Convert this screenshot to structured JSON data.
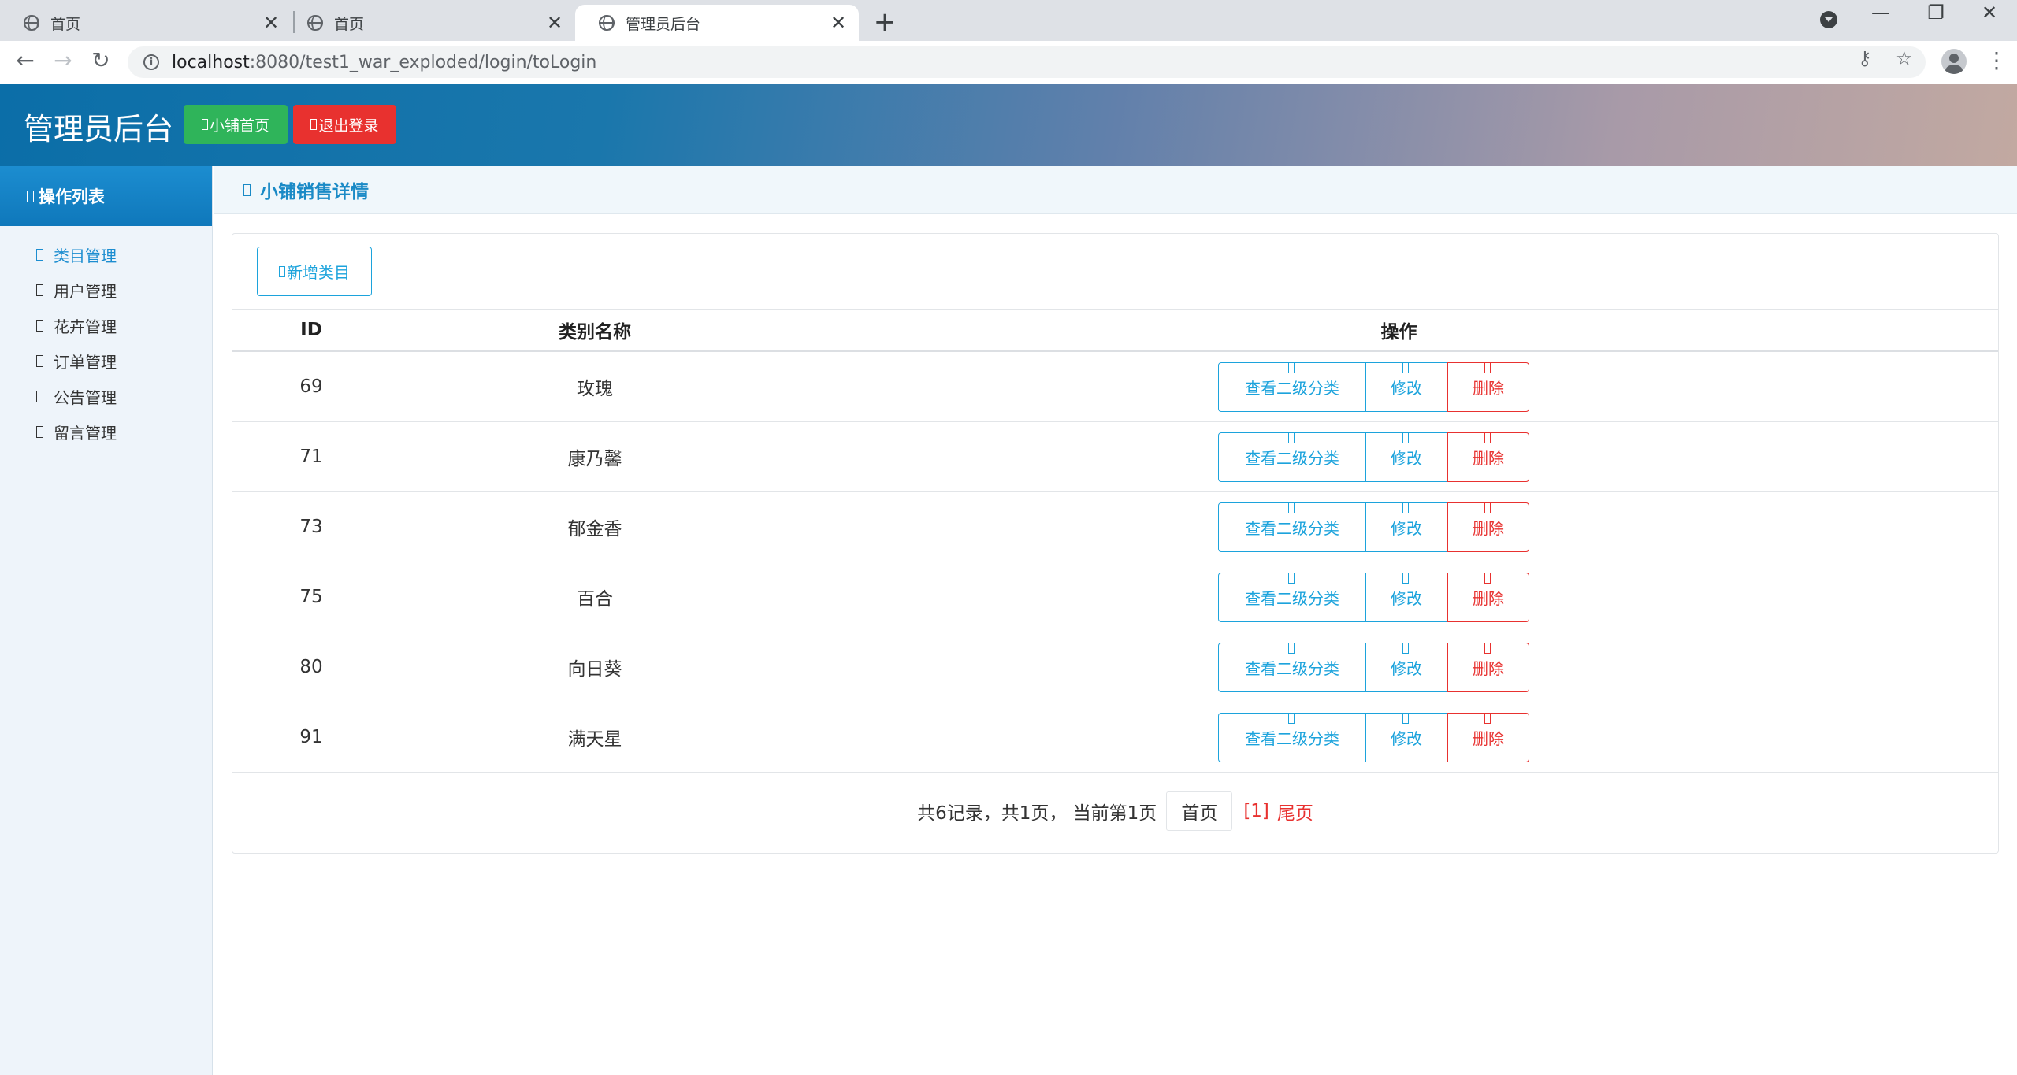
{
  "browser": {
    "tabs": [
      {
        "title": "首页",
        "active": false
      },
      {
        "title": "首页",
        "active": false
      },
      {
        "title": "管理员后台",
        "active": true
      }
    ],
    "new_tab": "+",
    "url_host": "localhost",
    "url_path": ":8080/test1_war_exploded/login/toLogin",
    "win_min": "—",
    "win_restore": "❐",
    "win_close": "✕",
    "back": "←",
    "forward": "→",
    "reload": "↻",
    "key_icon": "⚷",
    "star_icon": "☆",
    "kebab": "⋮",
    "close_glyph": "✕"
  },
  "header": {
    "title": "管理员后台",
    "home_button": "小铺首页",
    "logout_button": "退出登录"
  },
  "sidebar": {
    "heading": "操作列表",
    "items": [
      {
        "label": "类目管理",
        "active": true
      },
      {
        "label": "用户管理",
        "active": false
      },
      {
        "label": "花卉管理",
        "active": false
      },
      {
        "label": "订单管理",
        "active": false
      },
      {
        "label": "公告管理",
        "active": false
      },
      {
        "label": "留言管理",
        "active": false
      }
    ]
  },
  "main": {
    "section_title": "小铺销售详情",
    "add_button": "新增类目",
    "columns": [
      "ID",
      "类别名称",
      "操作"
    ],
    "rows": [
      {
        "id": "69",
        "name": "玫瑰"
      },
      {
        "id": "71",
        "name": "康乃馨"
      },
      {
        "id": "73",
        "name": "郁金香"
      },
      {
        "id": "75",
        "name": "百合"
      },
      {
        "id": "80",
        "name": "向日葵"
      },
      {
        "id": "91",
        "name": "满天星"
      }
    ],
    "row_actions": {
      "view": "查看二级分类",
      "edit": "修改",
      "delete": "删除"
    },
    "pager": {
      "summary": "共6记录，共1页， 当前第1页",
      "first": "首页",
      "current": "[1]",
      "last": "尾页"
    }
  },
  "colors": {
    "accent": "#1ca3dc",
    "danger": "#e8312f",
    "success": "#2fb45a"
  }
}
